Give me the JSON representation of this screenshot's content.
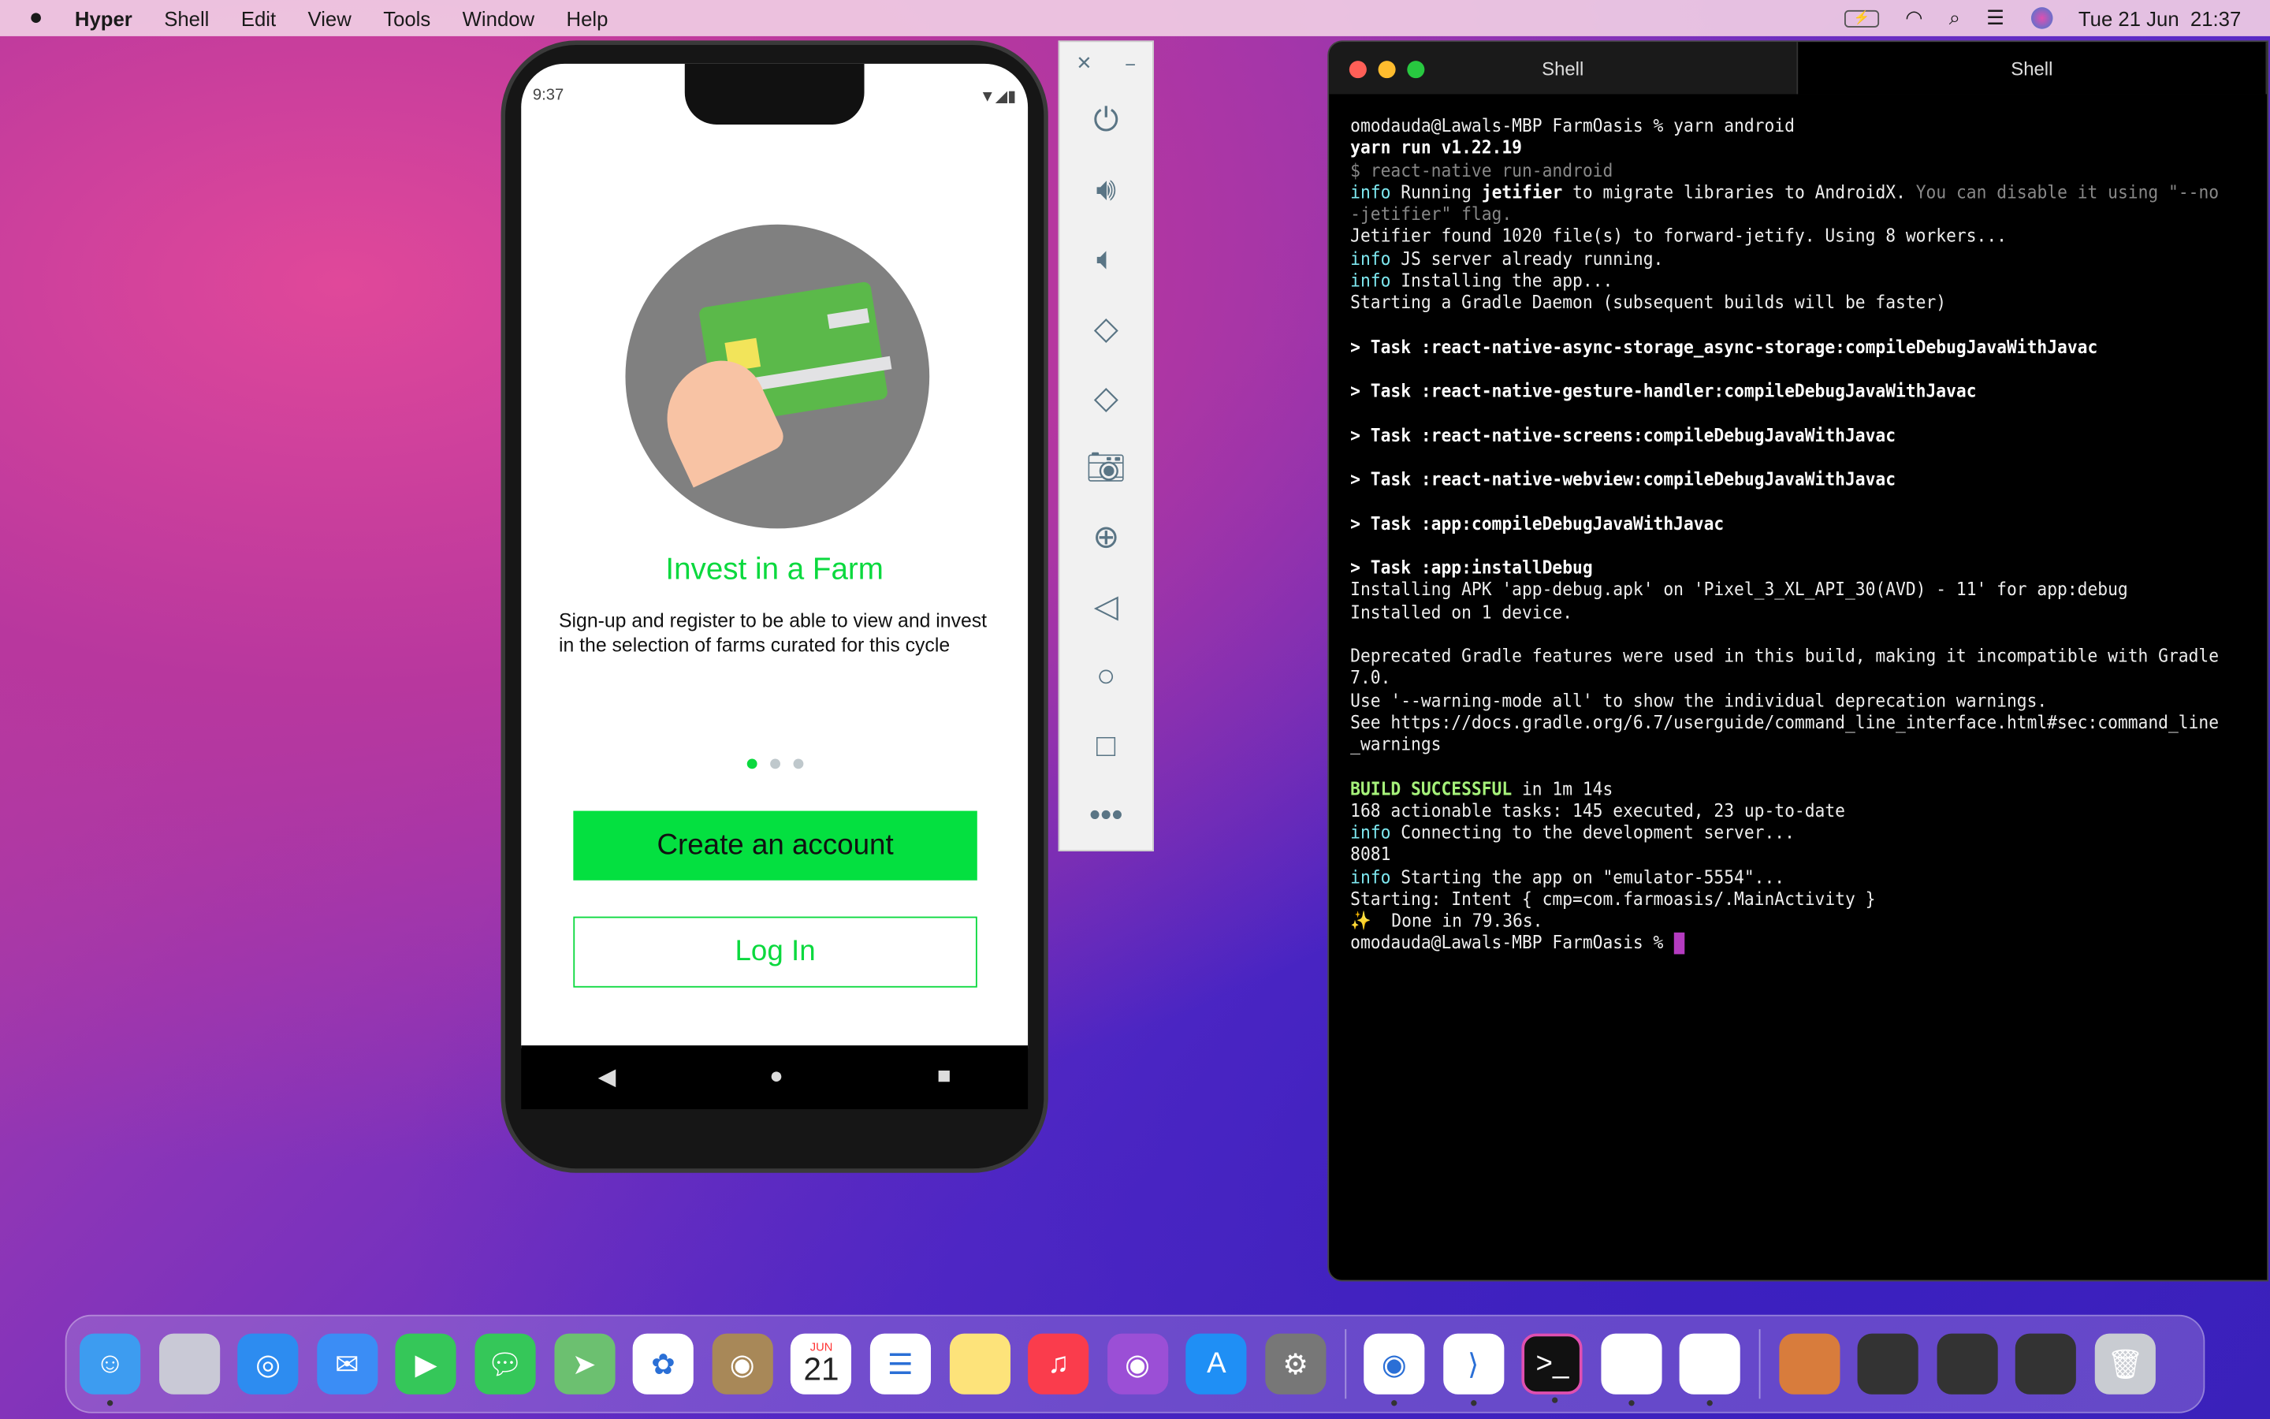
{
  "menubar": {
    "app": "Hyper",
    "items": [
      "Shell",
      "Edit",
      "View",
      "Tools",
      "Window",
      "Help"
    ],
    "datetime": "Tue 21 Jun  21:37",
    "status_icons": [
      "battery-charging-icon",
      "wifi-icon",
      "search-icon",
      "control-center-icon",
      "siri-icon"
    ]
  },
  "phone": {
    "time": "9:37",
    "title": "Invest in a Farm",
    "description": "Sign-up and register to be able to view and invest in the selection of farms curated for this cycle",
    "create_label": "Create an account",
    "login_label": "Log In",
    "page_index": 0,
    "page_count": 3,
    "accent": "#0bd93e"
  },
  "emulator_toolbar": {
    "icons": [
      "power-icon",
      "volume-up-icon",
      "volume-down-icon",
      "rotate-left-icon",
      "rotate-right-icon",
      "camera-icon",
      "zoom-icon",
      "back-icon",
      "home-icon",
      "overview-icon",
      "more-icon"
    ]
  },
  "terminal": {
    "tabs": [
      "Shell",
      "Shell"
    ],
    "lines": [
      [
        [
          "",
          "omodauda@Lawals-MBP FarmOasis % yarn android"
        ]
      ],
      [
        [
          "bold",
          "yarn run v1.22.19"
        ]
      ],
      [
        [
          "dim",
          "$ react-native run-android"
        ]
      ],
      [
        [
          "info",
          "info"
        ],
        [
          "",
          " Running "
        ],
        [
          "bold",
          "jetifier"
        ],
        [
          "",
          " to migrate libraries to AndroidX. "
        ],
        [
          "dim",
          "You can disable it using \"--no-jetifier\" flag."
        ]
      ],
      [
        [
          "",
          "Jetifier found 1020 file(s) to forward-jetify. Using 8 workers..."
        ]
      ],
      [
        [
          "info",
          "info"
        ],
        [
          "",
          " JS server already running."
        ]
      ],
      [
        [
          "info",
          "info"
        ],
        [
          "",
          " Installing the app..."
        ]
      ],
      [
        [
          "",
          "Starting a Gradle Daemon (subsequent builds will be faster)"
        ]
      ],
      [
        [
          "",
          ""
        ]
      ],
      [
        [
          "bold",
          "> Task :react-native-async-storage_async-storage:compileDebugJavaWithJavac"
        ]
      ],
      [
        [
          "",
          ""
        ]
      ],
      [
        [
          "bold",
          "> Task :react-native-gesture-handler:compileDebugJavaWithJavac"
        ]
      ],
      [
        [
          "",
          ""
        ]
      ],
      [
        [
          "bold",
          "> Task :react-native-screens:compileDebugJavaWithJavac"
        ]
      ],
      [
        [
          "",
          ""
        ]
      ],
      [
        [
          "bold",
          "> Task :react-native-webview:compileDebugJavaWithJavac"
        ]
      ],
      [
        [
          "",
          ""
        ]
      ],
      [
        [
          "bold",
          "> Task :app:compileDebugJavaWithJavac"
        ]
      ],
      [
        [
          "",
          ""
        ]
      ],
      [
        [
          "bold",
          "> Task :app:installDebug"
        ]
      ],
      [
        [
          "",
          "Installing APK 'app-debug.apk' on 'Pixel_3_XL_API_30(AVD) - 11' for app:debug"
        ]
      ],
      [
        [
          "",
          "Installed on 1 device."
        ]
      ],
      [
        [
          "",
          ""
        ]
      ],
      [
        [
          "",
          "Deprecated Gradle features were used in this build, making it incompatible with Gradle 7.0."
        ]
      ],
      [
        [
          "",
          "Use '--warning-mode all' to show the individual deprecation warnings."
        ]
      ],
      [
        [
          "",
          "See https://docs.gradle.org/6.7/userguide/command_line_interface.html#sec:command_line_warnings"
        ]
      ],
      [
        [
          "",
          ""
        ]
      ],
      [
        [
          "ok",
          "BUILD SUCCESSFUL"
        ],
        [
          "",
          " in 1m 14s"
        ]
      ],
      [
        [
          "",
          "168 actionable tasks: 145 executed, 23 up-to-date"
        ]
      ],
      [
        [
          "info",
          "info"
        ],
        [
          "",
          " Connecting to the development server..."
        ]
      ],
      [
        [
          "",
          "8081"
        ]
      ],
      [
        [
          "info",
          "info"
        ],
        [
          "",
          " Starting the app on \"emulator-5554\"..."
        ]
      ],
      [
        [
          "",
          "Starting: Intent { cmp=com.farmoasis/.MainActivity }"
        ]
      ],
      [
        [
          "",
          "✨  Done in 79.36s."
        ]
      ],
      [
        [
          "",
          "omodauda@Lawals-MBP FarmOasis % "
        ]
      ]
    ]
  },
  "dock": {
    "calendar_month": "JUN",
    "calendar_day": "21",
    "apps": [
      "finder",
      "launchpad",
      "safari",
      "mail",
      "facetime",
      "messages",
      "maps",
      "photos",
      "contacts",
      "calendar",
      "reminders",
      "notes",
      "music",
      "podcasts",
      "app-store",
      "system-preferences",
      "chrome",
      "vscode",
      "hyper",
      "xcode",
      "android-studio",
      "downloads",
      "window-1",
      "window-2",
      "window-3",
      "trash"
    ]
  }
}
